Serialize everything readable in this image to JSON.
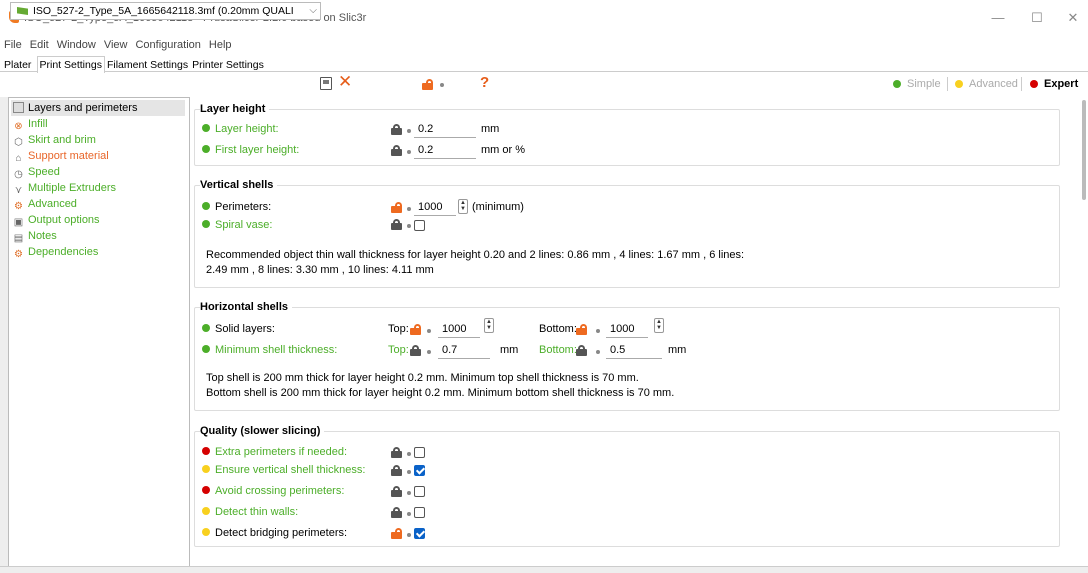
{
  "window": {
    "title": "ISO_527-2_Type_5A_1665642118 - PrusaSlicer-2.2.0 based on Slic3r",
    "minimize": "—",
    "maximize": "☐",
    "close": "✕"
  },
  "menu": [
    "File",
    "Edit",
    "Window",
    "View",
    "Configuration",
    "Help"
  ],
  "tabs": [
    "Plater",
    "Print Settings",
    "Filament Settings",
    "Printer Settings"
  ],
  "preset": {
    "value": "ISO_527-2_Type_5A_1665642118.3mf (0.20mm QUALI"
  },
  "toolbar": {
    "question": "?"
  },
  "modes": {
    "simple": "Simple",
    "advanced": "Advanced",
    "expert": "Expert"
  },
  "colors": {
    "green": "#4cae29",
    "yellow": "#f8d01f",
    "red": "#d50000",
    "orange": "#e8662a",
    "accent": "#0a62c8"
  },
  "sidebar": [
    {
      "label": "Layers and perimeters",
      "icon": "layers-icon"
    },
    {
      "label": "Infill",
      "icon": "infill-icon"
    },
    {
      "label": "Skirt and brim",
      "icon": "skirt-icon"
    },
    {
      "label": "Support material",
      "icon": "support-icon"
    },
    {
      "label": "Speed",
      "icon": "speed-icon"
    },
    {
      "label": "Multiple Extruders",
      "icon": "extruders-icon"
    },
    {
      "label": "Advanced",
      "icon": "advanced-icon"
    },
    {
      "label": "Output options",
      "icon": "output-icon"
    },
    {
      "label": "Notes",
      "icon": "notes-icon"
    },
    {
      "label": "Dependencies",
      "icon": "dependencies-icon"
    }
  ],
  "layer_height": {
    "title": "Layer height",
    "layer_height_label": "Layer height:",
    "layer_height_value": "0.2",
    "layer_height_unit": "mm",
    "first_layer_label": "First layer height:",
    "first_layer_value": "0.2",
    "first_layer_unit": "mm or %"
  },
  "vertical_shells": {
    "title": "Vertical shells",
    "perimeters_label": "Perimeters:",
    "perimeters_value": "1000",
    "perimeters_unit": "(minimum)",
    "spiral_label": "Spiral vase:",
    "note1": "Recommended object thin wall thickness for layer height 0.20 and 2 lines: 0.86 mm , 4 lines: 1.67 mm , 6 lines:",
    "note2": "2.49 mm , 8 lines: 3.30 mm , 10 lines: 4.11 mm"
  },
  "horizontal_shells": {
    "title": "Horizontal shells",
    "solid_label": "Solid layers:",
    "top_label": "Top:",
    "top_value": "1000",
    "bottom_label": "Bottom:",
    "bottom_value": "1000",
    "min_label": "Minimum shell thickness:",
    "min_top_label": "Top:",
    "min_top_value": "0.7",
    "min_top_unit": "mm",
    "min_bottom_label": "Bottom:",
    "min_bottom_value": "0.5",
    "min_bottom_unit": "mm",
    "note1": "Top shell is 200 mm thick for layer height 0.2 mm. Minimum top shell thickness is 70 mm.",
    "note2": "Bottom shell is 200 mm thick for layer height 0.2 mm. Minimum bottom shell thickness is 70 mm."
  },
  "quality": {
    "title": "Quality (slower slicing)",
    "items": [
      {
        "label": "Extra perimeters if needed:",
        "checked": false
      },
      {
        "label": "Ensure vertical shell thickness:",
        "checked": true
      },
      {
        "label": "Avoid crossing perimeters:",
        "checked": false
      },
      {
        "label": "Detect thin walls:",
        "checked": false
      },
      {
        "label": "Detect bridging perimeters:",
        "checked": true
      }
    ]
  }
}
